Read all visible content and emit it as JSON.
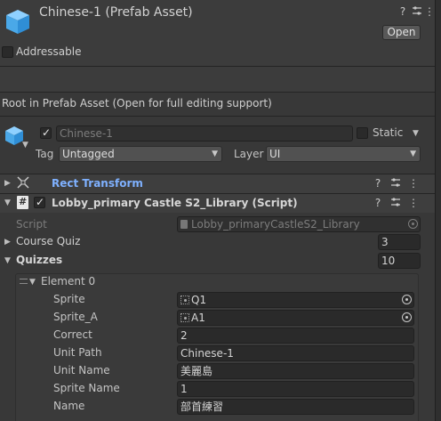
{
  "header": {
    "title": "Chinese-1 (Prefab Asset)",
    "open_label": "Open",
    "addressable_label": "Addressable",
    "help_glyph": "?",
    "more_glyph": "⋮"
  },
  "info": {
    "text": "Root in Prefab Asset (Open for full editing support)"
  },
  "gameobject": {
    "name": "Chinese-1",
    "static_label": "Static",
    "tag_label": "Tag",
    "tag_value": "Untagged",
    "layer_label": "Layer",
    "layer_value": "UI"
  },
  "components": {
    "rect_transform": {
      "title": "Rect Transform"
    },
    "script_component": {
      "title": "Lobby_primary Castle S2_Library (Script)"
    }
  },
  "script_fields": {
    "script_label": "Script",
    "script_value": "Lobby_primaryCastleS2_Library",
    "course_quiz_label": "Course Quiz",
    "course_quiz_value": "3",
    "quizzes_label": "Quizzes",
    "quizzes_value": "10"
  },
  "element0": {
    "title": "Element 0",
    "fields": [
      {
        "label": "Sprite",
        "value": "Q1"
      },
      {
        "label": "Sprite_A",
        "value": "A1"
      },
      {
        "label": "Correct",
        "value": "2"
      },
      {
        "label": "Unit Path",
        "value": "Chinese-1"
      },
      {
        "label": "Unit Name",
        "value": "美麗島"
      },
      {
        "label": "Sprite Name",
        "value": "1"
      },
      {
        "label": "Name",
        "value": "部首練習"
      }
    ]
  },
  "colors": {
    "background": "#383838",
    "field": "#2a2a2a",
    "accent_blue": "#7fb1ff"
  },
  "icons": [
    "prefab-cube-icon",
    "rect-transform-icon",
    "script-icon",
    "help-icon",
    "presets-icon",
    "more-icon",
    "object-picker-icon",
    "sprite-icon"
  ]
}
